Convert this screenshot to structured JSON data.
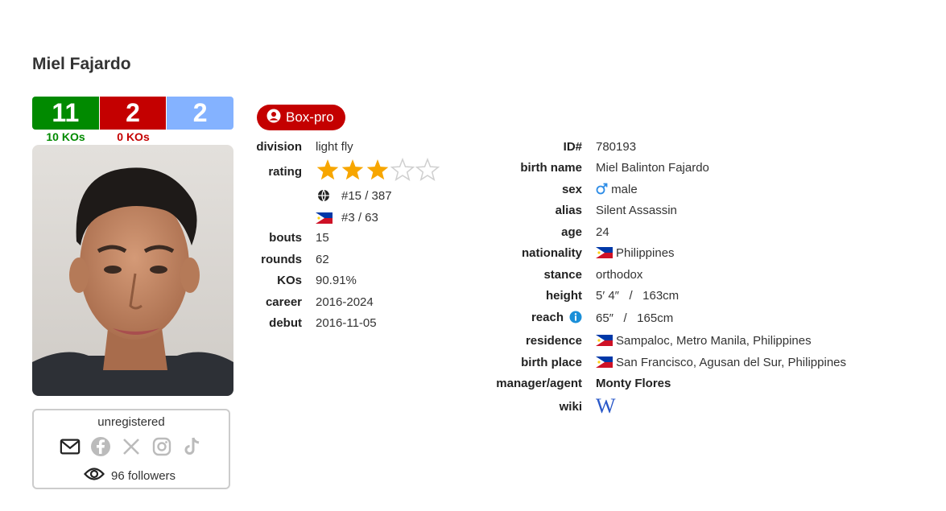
{
  "boxer": {
    "name": "Miel Fajardo",
    "record": {
      "wins": "11",
      "losses": "2",
      "draws": "2",
      "wins_kos": "10 KOs",
      "losses_kos": "0 KOs"
    },
    "badge": "Box-pro"
  },
  "left_details": {
    "division_label": "division",
    "division": "light fly",
    "rating_label": "rating",
    "rating_stars": 3,
    "rating_max": 5,
    "world_rank": "#15 / 387",
    "national_rank": "#3 / 63",
    "bouts_label": "bouts",
    "bouts": "15",
    "rounds_label": "rounds",
    "rounds": "62",
    "kos_label": "KOs",
    "kos": "90.91%",
    "career_label": "career",
    "career": "2016-2024",
    "debut_label": "debut",
    "debut": "2016-11-05"
  },
  "right_details": {
    "id_label": "ID#",
    "id": "780193",
    "birth_name_label": "birth name",
    "birth_name": "Miel Balinton Fajardo",
    "sex_label": "sex",
    "sex": "male",
    "alias_label": "alias",
    "alias": "Silent Assassin",
    "age_label": "age",
    "age": "24",
    "nationality_label": "nationality",
    "nationality": "Philippines",
    "stance_label": "stance",
    "stance": "orthodox",
    "height_label": "height",
    "height": "5′ 4″   /   163cm",
    "reach_label": "reach",
    "reach": "65″   /   165cm",
    "residence_label": "residence",
    "residence": "Sampaloc, Metro Manila, Philippines",
    "birth_place_label": "birth place",
    "birth_place": "San Francisco, Agusan del Sur, Philippines",
    "manager_label": "manager/agent",
    "manager": "Monty Flores",
    "wiki_label": "wiki",
    "wiki_icon": "W"
  },
  "social": {
    "status": "unregistered",
    "followers": "96 followers",
    "icons": [
      "mail-icon",
      "facebook-icon",
      "x-icon",
      "instagram-icon",
      "tiktok-icon"
    ]
  },
  "colors": {
    "win": "#018a00",
    "loss": "#c40000",
    "draw": "#84b2ff",
    "star": "#f7a600",
    "info": "#1a8fd8"
  }
}
